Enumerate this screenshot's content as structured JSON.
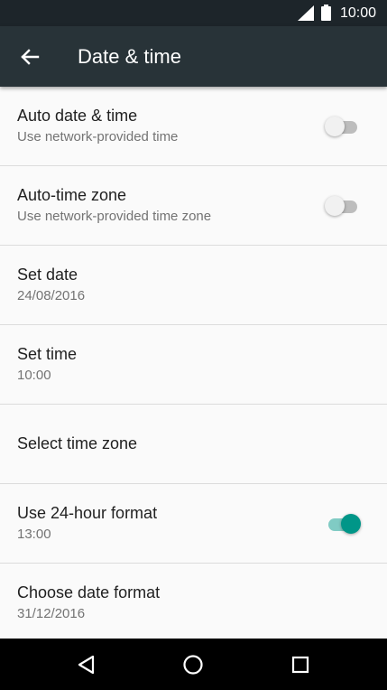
{
  "status_bar": {
    "time": "10:00",
    "icons": [
      "signal-icon",
      "battery-icon"
    ]
  },
  "toolbar": {
    "back_icon": "arrow-left-icon",
    "title": "Date & time"
  },
  "settings": [
    {
      "label": "Auto date & time",
      "sub": "Use network-provided time",
      "switch": false
    },
    {
      "label": "Auto-time zone",
      "sub": "Use network-provided time zone",
      "switch": false
    },
    {
      "label": "Set date",
      "sub": "24/08/2016"
    },
    {
      "label": "Set time",
      "sub": "10:00"
    },
    {
      "label": "Select time zone"
    },
    {
      "label": "Use 24-hour format",
      "sub": "13:00",
      "switch": true
    },
    {
      "label": "Choose date format",
      "sub": "31/12/2016"
    }
  ],
  "nav_bar": {
    "buttons": [
      "back-triangle-icon",
      "home-circle-icon",
      "recents-square-icon"
    ]
  },
  "colors": {
    "status_bar_bg": "#1d252a",
    "toolbar_bg": "#283338",
    "list_bg": "#fafafa",
    "accent": "#009688",
    "switch_track_on": "#80cbc4",
    "switch_track_off": "#bdbdbd",
    "nav_bar_bg": "#000000"
  }
}
